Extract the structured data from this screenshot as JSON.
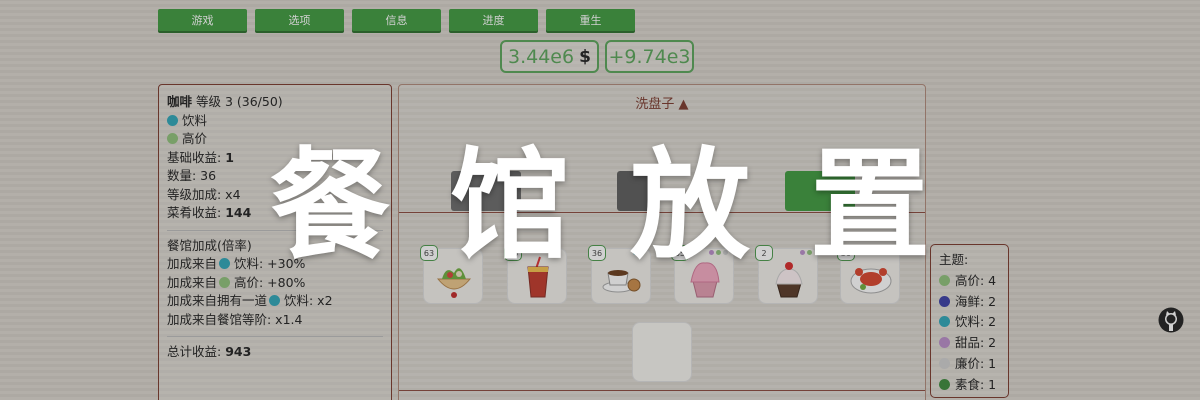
{
  "tabs": [
    "游戏",
    "选项",
    "信息",
    "进度",
    "重生"
  ],
  "money": {
    "total": "3.44e6",
    "currency": "$",
    "rate": "+9.74e3"
  },
  "details": {
    "name": "咖啡",
    "level_text": "等级 3 (36/50)",
    "tags": [
      {
        "label": "饮料",
        "color": "#2fa6b8"
      },
      {
        "label": "高价",
        "color": "#8fc07a"
      }
    ],
    "base_label": "基础收益: ",
    "base_value": "1",
    "count_text": "数量: 36",
    "level_bonus_text": "等级加成: x4",
    "dish_income_label": "菜肴收益: ",
    "dish_income_value": "144",
    "restaurant_bonus_title": "餐馆加成(倍率)",
    "bonus_from": "加成来自",
    "bonus1_rest": " 饮料: +30%",
    "bonus2_rest": " 高价: +80%",
    "bonus3_prefix": "加成来自拥有一道",
    "bonus3_rest": " 饮料: x2",
    "bonus4": "加成来自餐馆等阶: x1.4",
    "total_label": "总计收益: ",
    "total_value": "943"
  },
  "main": {
    "title": "洗盘子 ▲"
  },
  "dishes": [
    {
      "count": "63",
      "icon": "salad-icon",
      "dots": []
    },
    {
      "count": "36",
      "icon": "drink-icon",
      "dots": []
    },
    {
      "count": "36",
      "icon": "coffee-icon",
      "dots": [
        "#2fa6b8",
        "#8fc07a"
      ]
    },
    {
      "count": "35",
      "icon": "cupcake-icon",
      "dots": [
        "#b98dc8",
        "#8fc07a",
        "#cfcfcf"
      ]
    },
    {
      "count": "2",
      "icon": "cherry-cupcake-icon",
      "dots": [
        "#b98dc8",
        "#8fc07a"
      ]
    },
    {
      "count": "30",
      "icon": "crab-icon",
      "dots": [
        "#3b3fa6"
      ]
    }
  ],
  "themes": {
    "title": "主题:",
    "items": [
      {
        "label": "高价: 4",
        "color": "#8fc07a"
      },
      {
        "label": "海鲜: 2",
        "color": "#3b3fa6"
      },
      {
        "label": "饮料: 2",
        "color": "#2fa6b8"
      },
      {
        "label": "甜品: 2",
        "color": "#b98dc8"
      },
      {
        "label": "廉价: 1",
        "color": "#cfcfcf"
      },
      {
        "label": "素食: 1",
        "color": "#3d8a3d"
      }
    ]
  },
  "banner": "餐馆放置",
  "colors": {
    "accent": "#3f9a3f",
    "border": "#7b3a2e"
  }
}
